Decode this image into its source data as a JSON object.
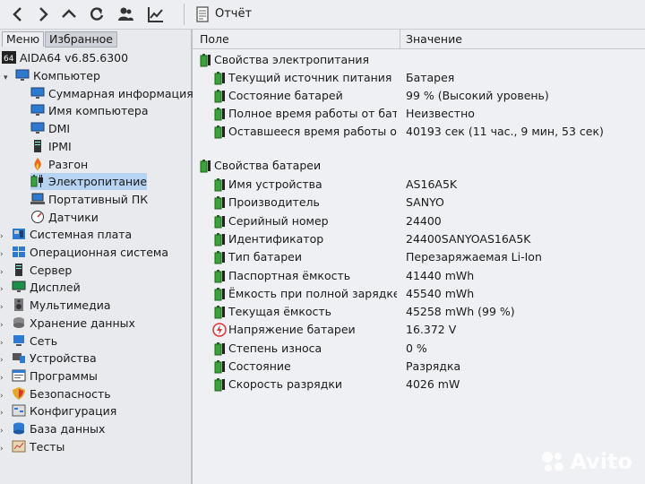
{
  "toolbar": {
    "report_label": "Отчёт"
  },
  "left": {
    "tabs": {
      "menu": "Меню",
      "favorites": "Избранное"
    },
    "app": "AIDA64 v6.85.6300",
    "tree": [
      {
        "label": "Компьютер",
        "icon": "monitor-icon"
      },
      {
        "label": "Суммарная информация",
        "icon": "monitor-icon"
      },
      {
        "label": "Имя компьютера",
        "icon": "monitor-icon"
      },
      {
        "label": "DMI",
        "icon": "monitor-icon"
      },
      {
        "label": "IPMI",
        "icon": "server-icon"
      },
      {
        "label": "Разгон",
        "icon": "flame-icon"
      },
      {
        "label": "Электропитание",
        "icon": "battery-plug-icon"
      },
      {
        "label": "Портативный ПК",
        "icon": "laptop-icon"
      },
      {
        "label": "Датчики",
        "icon": "gauge-icon"
      },
      {
        "label": "Системная плата",
        "icon": "motherboard-icon"
      },
      {
        "label": "Операционная система",
        "icon": "windows-icon"
      },
      {
        "label": "Сервер",
        "icon": "server-icon"
      },
      {
        "label": "Дисплей",
        "icon": "display-icon"
      },
      {
        "label": "Мультимедиа",
        "icon": "speaker-icon"
      },
      {
        "label": "Хранение данных",
        "icon": "disk-icon"
      },
      {
        "label": "Сеть",
        "icon": "network-icon"
      },
      {
        "label": "Устройства",
        "icon": "devices-icon"
      },
      {
        "label": "Программы",
        "icon": "programs-icon"
      },
      {
        "label": "Безопасность",
        "icon": "shield-icon"
      },
      {
        "label": "Конфигурация",
        "icon": "config-icon"
      },
      {
        "label": "База данных",
        "icon": "database-icon"
      },
      {
        "label": "Тесты",
        "icon": "tests-icon"
      }
    ]
  },
  "right": {
    "columns": {
      "field": "Поле",
      "value": "Значение"
    },
    "power_section": "Свойства электропитания",
    "power_rows": [
      {
        "name": "Текущий источник питания",
        "value": "Батарея"
      },
      {
        "name": "Состояние батарей",
        "value": "99 % (Высокий уровень)"
      },
      {
        "name": "Полное время работы от батареи",
        "value": "Неизвестно"
      },
      {
        "name": "Оставшееся время работы от батареи",
        "value": "40193 сек (11 час., 9 мин, 53 сек)"
      }
    ],
    "battery_section": "Свойства батареи",
    "battery_rows": [
      {
        "name": "Имя устройства",
        "value": "AS16A5K"
      },
      {
        "name": "Производитель",
        "value": "SANYO"
      },
      {
        "name": "Серийный номер",
        "value": "24400"
      },
      {
        "name": "Идентификатор",
        "value": "24400SANYOAS16A5K"
      },
      {
        "name": "Тип батареи",
        "value": "Перезаряжаемая Li-Ion"
      },
      {
        "name": "Паспортная ёмкость",
        "value": "41440 mWh"
      },
      {
        "name": "Ёмкость при полной зарядке",
        "value": "45540 mWh"
      },
      {
        "name": "Текущая ёмкость",
        "value": "45258 mWh  (99 %)"
      },
      {
        "name": "Напряжение батареи",
        "value": "16.372 V"
      },
      {
        "name": "Степень износа",
        "value": "0 %"
      },
      {
        "name": "Состояние",
        "value": "Разрядка"
      },
      {
        "name": "Скорость разрядки",
        "value": "4026 mW"
      }
    ]
  },
  "watermark": "Avito"
}
